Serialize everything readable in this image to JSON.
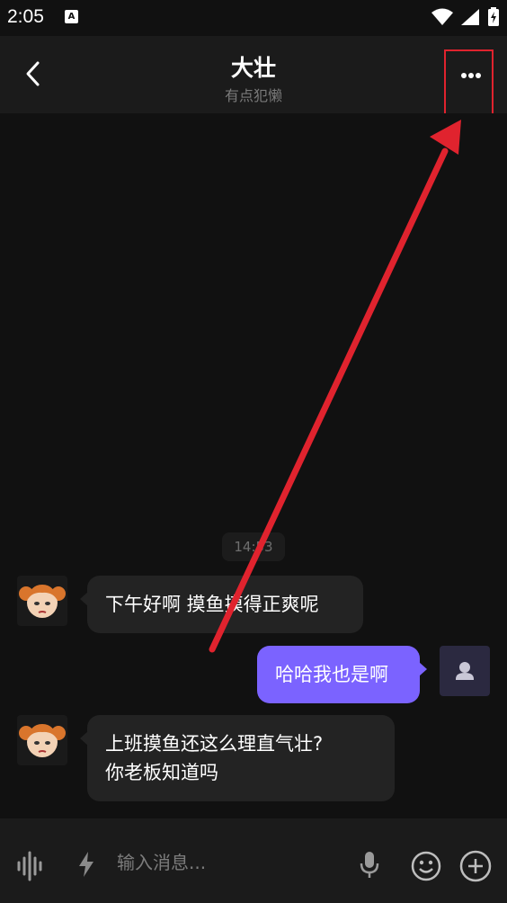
{
  "status_bar": {
    "time": "2:05",
    "notification_icon": "a-badge-icon",
    "wifi_icon": "wifi-icon",
    "signal_icon": "signal-icon",
    "battery_icon": "battery-charging-icon"
  },
  "header": {
    "title": "大壮",
    "subtitle": "有点犯懒",
    "back_icon": "chevron-left-icon",
    "more_icon": "more-dots-icon"
  },
  "chat": {
    "timestamp": "14:53",
    "messages": [
      {
        "side": "left",
        "sender_avatar": "cartoon-girl-avatar",
        "lines": [
          "下午好啊 摸鱼摸得正爽呢"
        ]
      },
      {
        "side": "right",
        "sender_avatar": "default-user-avatar",
        "lines": [
          "哈哈我也是啊"
        ]
      },
      {
        "side": "left",
        "sender_avatar": "cartoon-girl-avatar",
        "lines": [
          "上班摸鱼还这么理直气壮?",
          "你老板知道吗"
        ]
      }
    ]
  },
  "input_bar": {
    "placeholder": "输入消息...",
    "icons": [
      "voice-wave-icon",
      "lightning-icon",
      "microphone-icon",
      "emoji-icon",
      "add-icon"
    ]
  },
  "annotation": {
    "highlight_color": "#e0232e"
  },
  "colors": {
    "background": "#111111",
    "header": "#1b1b1b",
    "bubble_received": "#232323",
    "bubble_sent": "#7b63ff"
  }
}
